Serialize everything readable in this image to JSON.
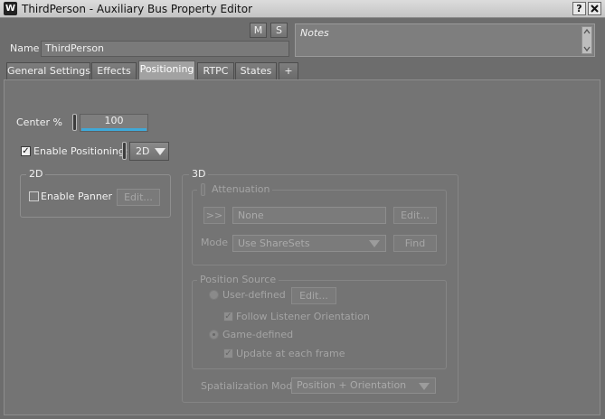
{
  "window": {
    "title": "ThirdPerson - Auxiliary Bus Property Editor",
    "app_icon": "wwise-logo-icon",
    "help_label": "?",
    "close_label": "X"
  },
  "header": {
    "mute_label": "M",
    "solo_label": "S",
    "name_label": "Name",
    "name_value": "ThirdPerson",
    "notes_placeholder": "Notes"
  },
  "tabs": [
    {
      "label": "General Settings"
    },
    {
      "label": "Effects"
    },
    {
      "label": "Positioning",
      "active": true
    },
    {
      "label": "RTPC"
    },
    {
      "label": "States"
    },
    {
      "label": "+"
    }
  ],
  "positioning": {
    "center_label": "Center %",
    "center_value": "100",
    "enable_positioning_label": "Enable Positioning:",
    "enable_positioning_checked": true,
    "mode_value": "2D"
  },
  "group_2d": {
    "title": "2D",
    "enable_panner_label": "Enable Panner",
    "enable_panner_checked": false,
    "edit_label": "Edit..."
  },
  "group_3d": {
    "title": "3D",
    "attenuation": {
      "title": "Attenuation",
      "browse_label": ">>",
      "value": "None",
      "edit_label": "Edit...",
      "mode_label": "Mode",
      "mode_value": "Use ShareSets",
      "find_label": "Find"
    },
    "position_source": {
      "title": "Position Source",
      "user_defined_label": "User-defined",
      "edit_label": "Edit...",
      "follow_listener_label": "Follow Listener Orientation",
      "game_defined_label": "Game-defined",
      "update_each_frame_label": "Update at each frame"
    },
    "spatialization_label": "Spatialization Mode",
    "spatialization_value": "Position + Orientation"
  },
  "colors": {
    "background": "#6d6d6d",
    "panel": "#747474",
    "titlebar": "#cfcfcf",
    "slider_fill": "#3fa9d8"
  }
}
